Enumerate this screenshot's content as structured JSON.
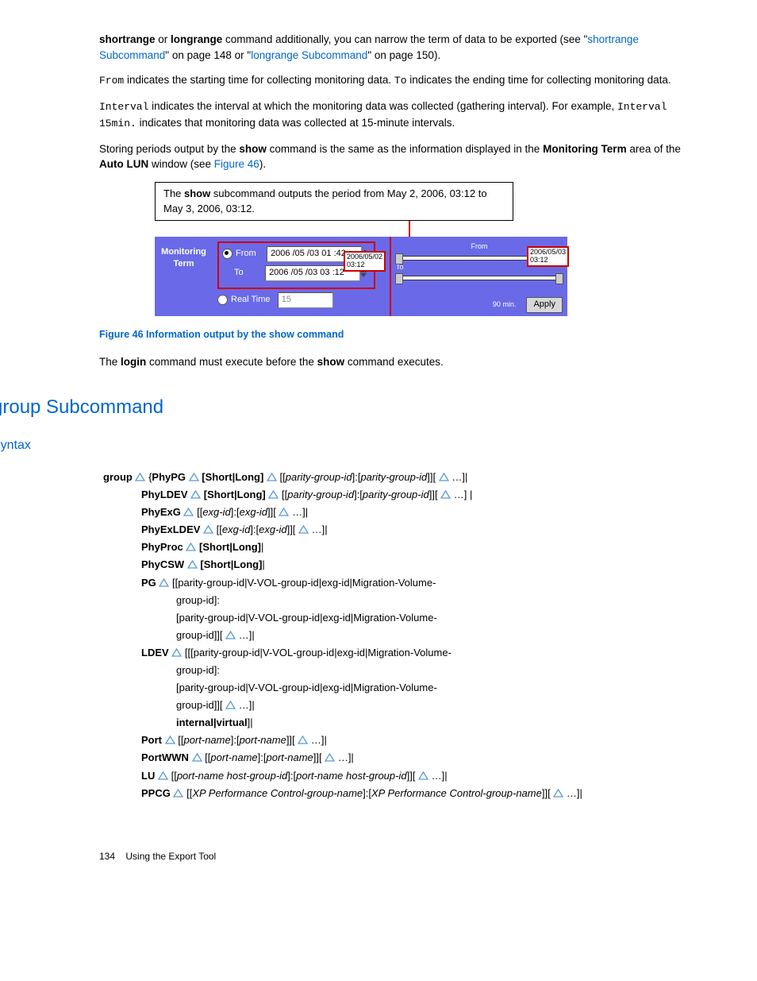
{
  "para1": {
    "a": "shortrange",
    "b": " or ",
    "c": "longrange",
    "d": " command additionally, you can narrow the term of data to be exported (see \"",
    "link1": "shortrange Subcommand",
    "e": "\" on page 148 or \"",
    "link2": "longrange Subcommand",
    "f": "\" on page 150)."
  },
  "para2": {
    "a": "From",
    "b": " indicates the starting time for collecting monitoring data. ",
    "c": "To",
    "d": " indicates the ending time for collecting monitoring data."
  },
  "para3": {
    "a": "Interval",
    "b": " indicates the interval at which the monitoring data was collected (gathering interval). For example, ",
    "c": "Interval 15min.",
    "d": " indicates that monitoring data was collected at 15-minute intervals."
  },
  "para4": {
    "a": "Storing periods output by the ",
    "b": "show",
    "c": " command is the same as the information displayed in the ",
    "d": "Monitoring Term",
    "e": " area of the ",
    "f": "Auto LUN",
    "g": " window (see ",
    "link": "Figure 46",
    "h": ")."
  },
  "fig": {
    "textbox_a": "The ",
    "textbox_b": "show",
    "textbox_c": " subcommand outputs the period from May 2, 2006, 03:12 to May 3, 2006, 03:12.",
    "monitoring_term": "Monitoring Term",
    "from_lbl": "From",
    "from_val": "2006 /05 /03  01 :42",
    "to_lbl": "To",
    "to_val": "2006 /05 /03  03 :12",
    "realtime": "Real Time",
    "realtime_val": "15",
    "tl_from": "From",
    "tl_to": "To",
    "tip1a": "2006/05/02",
    "tip1b": "03:12",
    "tip2a": "2006/05/03",
    "tip2b": "03:12",
    "ninety": "90 min.",
    "apply": "Apply"
  },
  "figcaption": "Figure 46 Information output by the show command",
  "para5": {
    "a": "The ",
    "b": "login",
    "c": " command must execute before the ",
    "d": "show",
    "e": " command executes."
  },
  "h1": "group Subcommand",
  "h2": "Syntax",
  "syn": {
    "group": "group",
    "phypg": "PhyPG",
    "shortlong_br": "[Short|Long]",
    "pg_ids": "parity-group-id",
    "phyldev": "PhyLDEV",
    "phyexg": "PhyExG",
    "exgid": "exg-id",
    "phyexldev": "PhyExLDEV",
    "phyproc": "PhyProc",
    "phycsw": "PhyCSW",
    "pg": "PG",
    "pg_tail1": " [[parity-group-id|V-VOL-group-id|exg-id|Migration-Volume-",
    "pg_tail2": "group-id]:",
    "pg_tail3": "[parity-group-id|V-VOL-group-id|exg-id|Migration-Volume-",
    "pg_tail4": "group-id]][",
    "ldev": "LDEV",
    "ldev_tail1": " [[[parity-group-id|V-VOL-group-id|exg-id|Migration-Volume-",
    "int_virt": "internal|virtual",
    "port": "Port",
    "portname": "port-name",
    "portwwn": "PortWWN",
    "lu": "LU",
    "lu_ids": "port-name host-group-id",
    "ppcg": "PPCG",
    "ppcg_ids": "XP Performance Control-group-name",
    "dots": " …]|",
    "dots_sp": " …] |",
    "dots_close": " …]]|"
  },
  "footer": {
    "page": "134",
    "title": "Using the Export Tool"
  }
}
